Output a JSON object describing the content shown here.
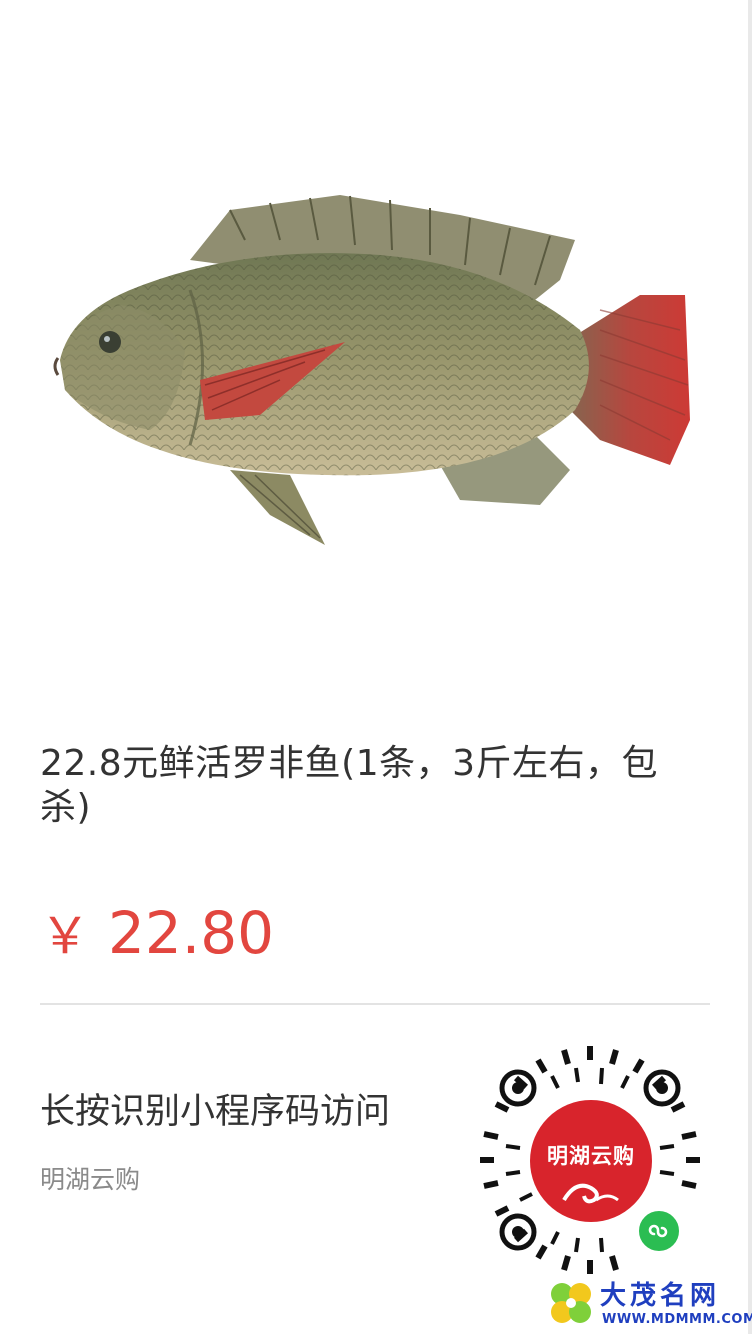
{
  "product": {
    "title": "22.8元鲜活罗非鱼(1条，3斤左右，包杀)",
    "currency_symbol": "￥",
    "price": "22.80",
    "image_icon": "tilapia-fish-image"
  },
  "share": {
    "hint": "长按识别小程序码访问",
    "shop_name": "明湖云购",
    "qr_brand_text": "明湖云购",
    "qr_icon": "mini-program-qr-code",
    "badge_icon": "wechat-mini-program-icon"
  },
  "watermark": {
    "name": "大茂名网",
    "url": "WWW.MDMMM.COM",
    "logo_icon": "clover-logo"
  },
  "colors": {
    "price": "#e2463f",
    "title": "#333333",
    "sub": "#8a8a8a",
    "brand_red": "#d8242c",
    "wechat_green": "#2bbd52",
    "watermark_blue": "#1f3fbf"
  }
}
